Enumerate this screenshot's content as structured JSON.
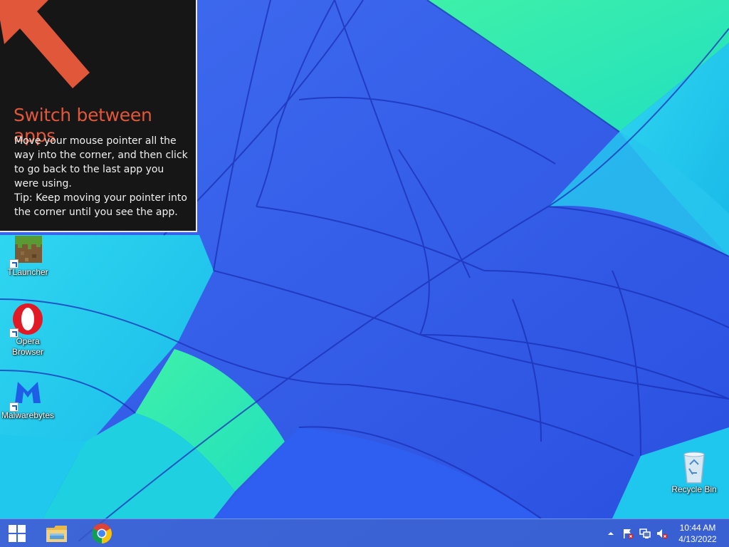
{
  "tip": {
    "title": "Switch between apps",
    "body_1": "Move your mouse pointer all the way into the corner, and then click to go back to the last app you were using.",
    "body_2": "Tip: Keep moving your pointer into the corner until you see the app.",
    "accent_color": "#e0573a"
  },
  "desktop_icons": [
    {
      "label": "TLauncher",
      "icon": "minecraft-grass-block-icon"
    },
    {
      "label": "Opera Browser",
      "icon": "opera-icon"
    },
    {
      "label": "Malwarebytes",
      "icon": "malwarebytes-icon"
    },
    {
      "label": "Recycle Bin",
      "icon": "recycle-bin-icon"
    }
  ],
  "taskbar": {
    "pinned": [
      "windows-start-icon",
      "file-explorer-icon",
      "chrome-icon"
    ],
    "tray": [
      "show-hidden-icons-chevron",
      "action-center-flag-icon",
      "network-icon",
      "volume-muted-icon"
    ],
    "time": "10:44 AM",
    "date": "4/13/2022"
  }
}
